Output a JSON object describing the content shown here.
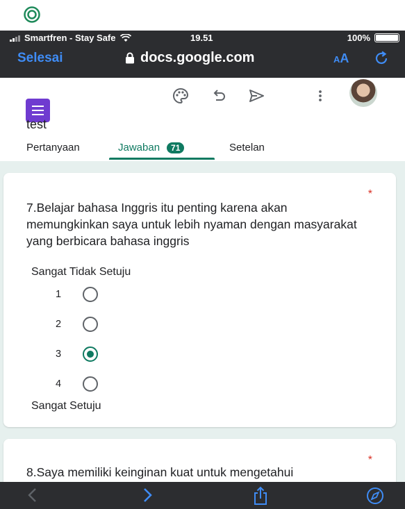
{
  "status_bar": {
    "carrier": "Smartfren - Stay Safe",
    "time": "19.51",
    "battery": "100%"
  },
  "browser": {
    "done_label": "Selesai",
    "url": "docs.google.com",
    "text_size_label_small": "A",
    "text_size_label_large": "A",
    "icons": [
      "lock-icon",
      "reload-icon"
    ]
  },
  "form": {
    "title": "test",
    "toolbar_icons": [
      "palette-icon",
      "undo-icon",
      "send-icon",
      "more-icon"
    ],
    "tabs": [
      {
        "label": "Pertanyaan"
      },
      {
        "label": "Jawaban",
        "badge": "71"
      },
      {
        "label": "Setelan"
      }
    ],
    "active_tab": "Jawaban"
  },
  "questions": [
    {
      "text": "7.Belajar bahasa Inggris itu penting karena akan memungkinkan saya untuk lebih nyaman dengan masyarakat yang berbicara bahasa inggris",
      "required_mark": "*",
      "low_label": "Sangat Tidak Setuju",
      "high_label": "Sangat Setuju",
      "options": [
        "1",
        "2",
        "3",
        "4"
      ],
      "selected": "3"
    },
    {
      "text": "8.Saya memiliki keinginan kuat untuk mengetahui",
      "required_mark": "*"
    }
  ],
  "bottom_toolbar_icons": [
    "back-icon",
    "forward-icon",
    "share-icon",
    "compass-icon"
  ],
  "colors": {
    "accent": "#0f7a61",
    "ios_blue": "#3f8cf5",
    "required": "#d93025",
    "form_purple": "#6f3bd0",
    "background": "#e6f0ee"
  }
}
